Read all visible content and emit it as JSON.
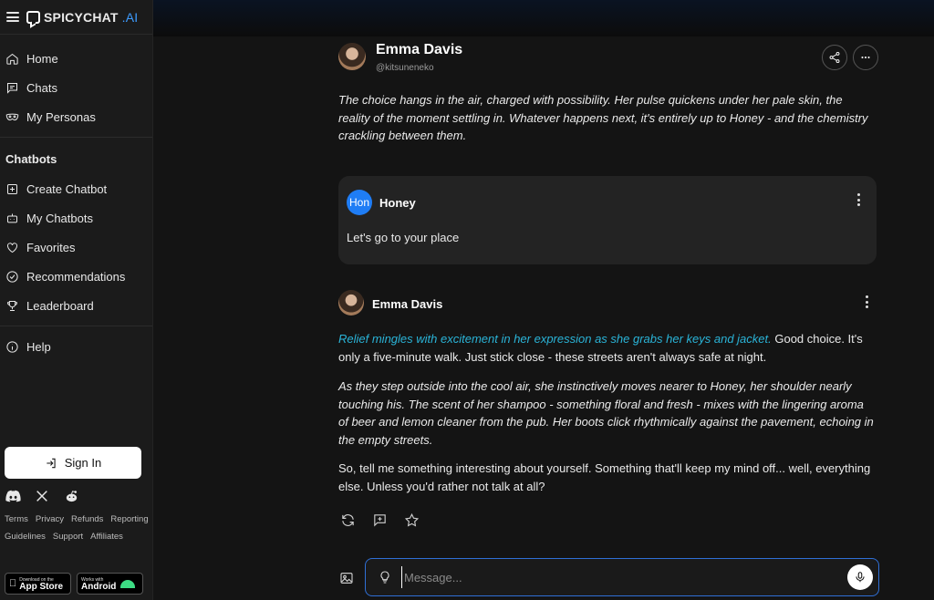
{
  "brand": {
    "name": "SPICYCHAT",
    "suffix": ".AI",
    "accent": "#3d9bff"
  },
  "sidebar": {
    "main_items": [
      {
        "label": "Home",
        "icon": "home-icon"
      },
      {
        "label": "Chats",
        "icon": "chat-icon"
      },
      {
        "label": "My Personas",
        "icon": "mask-icon"
      }
    ],
    "section_title": "Chatbots",
    "chatbot_items": [
      {
        "label": "Create Chatbot",
        "icon": "plus-square-icon"
      },
      {
        "label": "My Chatbots",
        "icon": "robot-icon"
      },
      {
        "label": "Favorites",
        "icon": "heart-icon"
      },
      {
        "label": "Recommendations",
        "icon": "check-circle-icon"
      },
      {
        "label": "Leaderboard",
        "icon": "trophy-icon"
      }
    ],
    "help": {
      "label": "Help",
      "icon": "info-icon"
    },
    "sign_in": "Sign In",
    "footer_links": [
      "Terms",
      "Privacy",
      "Refunds",
      "Reporting",
      "Guidelines",
      "Support",
      "Affiliates"
    ],
    "app_store": {
      "small": "Download on the",
      "big": "App Store"
    },
    "google_play": {
      "small": "Works with",
      "big": "Android"
    }
  },
  "header": {
    "name": "Emma Davis",
    "handle": "@kitsuneneko"
  },
  "messages": {
    "intro": "The choice hangs in the air, charged with possibility. Her pulse quickens under her pale skin, the reality of the moment settling in. Whatever happens next, it's entirely up to Honey - and the chemistry crackling between them.",
    "user": {
      "avatar_text": "Hon",
      "name": "Honey",
      "text": "Let's go to your place",
      "avatar_color": "#1f7df5"
    },
    "bot": {
      "name": "Emma Davis",
      "p1_narration": "Relief mingles with excitement in her expression as she grabs her keys and jacket.",
      "p1_speech": " Good choice. It's only a five-minute walk. Just stick close - these streets aren't always safe at night.",
      "p2_narration": "As they step outside into the cool air, she instinctively moves nearer to Honey, her shoulder nearly touching his. The scent of her shampoo - something floral and fresh - mixes with the lingering aroma of beer and lemon cleaner from the pub. Her boots click rhythmically against the pavement, echoing in the empty streets.",
      "p3_speech": "So, tell me something interesting about yourself. Something that'll keep my mind off... well, everything else. Unless you'd rather not talk at all?"
    },
    "narration_color": "#2ab4d8"
  },
  "composer": {
    "placeholder": "Message..."
  }
}
